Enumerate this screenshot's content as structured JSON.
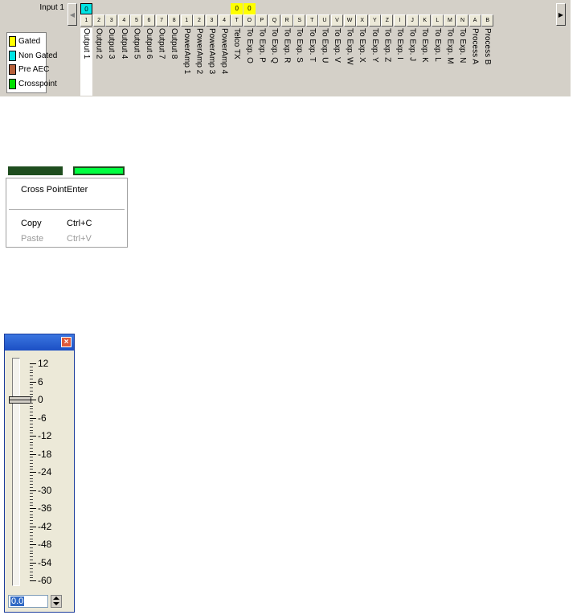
{
  "matrix": {
    "input_label": "Input 1",
    "legend": [
      {
        "label": "Gated",
        "color": "#ffff00"
      },
      {
        "label": "Non Gated",
        "color": "#00e5e5"
      },
      {
        "label": "Pre AEC",
        "color": "#b5603a"
      },
      {
        "label": "Crosspoint",
        "color": "#00e000"
      }
    ],
    "values": [
      {
        "col": 0,
        "text": "0",
        "color": "#00e5e5"
      },
      {
        "col": 12,
        "text": "0",
        "color": "#ffff00"
      },
      {
        "col": 13,
        "text": "0",
        "color": "#ffff00"
      }
    ],
    "columns": [
      {
        "button": "1",
        "label": "Output 1"
      },
      {
        "button": "2",
        "label": "Output 2"
      },
      {
        "button": "3",
        "label": "Output 3"
      },
      {
        "button": "4",
        "label": "Output 4"
      },
      {
        "button": "5",
        "label": "Output 5"
      },
      {
        "button": "6",
        "label": "Output 6"
      },
      {
        "button": "7",
        "label": "Output 7"
      },
      {
        "button": "8",
        "label": "Output 8"
      },
      {
        "button": "1",
        "label": "PowerAmp 1"
      },
      {
        "button": "2",
        "label": "PowerAmp 2"
      },
      {
        "button": "3",
        "label": "PowerAmp 3"
      },
      {
        "button": "4",
        "label": "PowerAmp 4"
      },
      {
        "button": "T",
        "label": "Telco TX"
      },
      {
        "button": "O",
        "label": "To Exp. O"
      },
      {
        "button": "P",
        "label": "To Exp. P"
      },
      {
        "button": "Q",
        "label": "To Exp. Q"
      },
      {
        "button": "R",
        "label": "To Exp. R"
      },
      {
        "button": "S",
        "label": "To Exp. S"
      },
      {
        "button": "T",
        "label": "To Exp. T"
      },
      {
        "button": "U",
        "label": "To Exp. U"
      },
      {
        "button": "V",
        "label": "To Exp. V"
      },
      {
        "button": "W",
        "label": "To Exp. W"
      },
      {
        "button": "X",
        "label": "To Exp. X"
      },
      {
        "button": "Y",
        "label": "To Exp. Y"
      },
      {
        "button": "Z",
        "label": "To Exp. Z"
      },
      {
        "button": "I",
        "label": "To Exp. I"
      },
      {
        "button": "J",
        "label": "To Exp. J"
      },
      {
        "button": "K",
        "label": "To Exp. K"
      },
      {
        "button": "L",
        "label": "To Exp. L"
      },
      {
        "button": "M",
        "label": "To Exp. M"
      },
      {
        "button": "N",
        "label": "To Exp. N"
      },
      {
        "button": "A",
        "label": "Process A"
      },
      {
        "button": "B",
        "label": "Process B"
      }
    ],
    "selected_column": 0
  },
  "menu": {
    "items": [
      {
        "label": "Cross Point",
        "shortcut": "Enter",
        "disabled": false
      },
      {
        "label": "Copy",
        "shortcut": "Ctrl+C",
        "disabled": false
      },
      {
        "label": "Paste",
        "shortcut": "Ctrl+V",
        "disabled": true
      }
    ],
    "strip_colors": [
      "#1e4d1e",
      "#00ff40"
    ]
  },
  "fader": {
    "close_symbol": "×",
    "scale_labels": [
      "12",
      "6",
      "0",
      "-6",
      "-12",
      "-18",
      "-24",
      "-30",
      "-36",
      "-42",
      "-48",
      "-54",
      "-60"
    ],
    "value_text": "0.0",
    "level_db": 0
  }
}
